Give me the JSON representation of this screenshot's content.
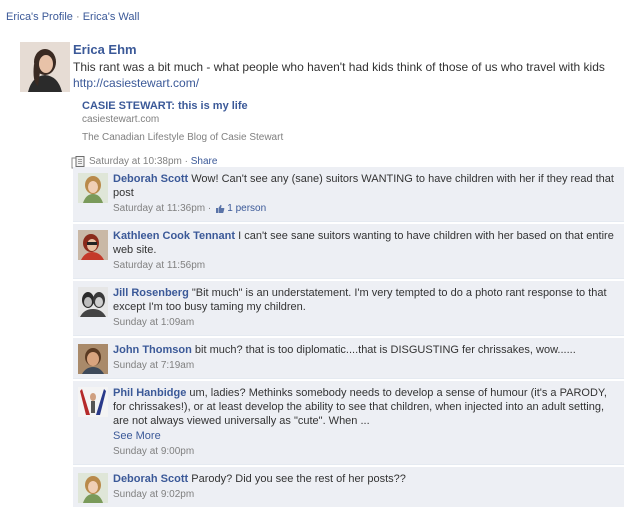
{
  "breadcrumb": {
    "profile": "Erica's Profile",
    "separator": "·",
    "wall": "Erica's Wall"
  },
  "post": {
    "author": "Erica Ehm",
    "text": "This rant was a bit much - what people who haven't had kids think of those of us who travel with kids",
    "link_text": "http://casiestewart.com/",
    "attachment": {
      "title": "CASIE STEWART: this is my life",
      "domain": "casiestewart.com",
      "description": "The Canadian Lifestyle Blog of Casie Stewart"
    },
    "timestamp": "Saturday at 10:38pm",
    "separator": "·",
    "share_label": "Share"
  },
  "comments": [
    {
      "author": "Deborah Scott",
      "text": "Wow! Can't see any (sane) suitors WANTING to have children with her if they read that post",
      "timestamp": "Saturday at 11:36pm",
      "separator": "·",
      "likes": "1 person"
    },
    {
      "author": "Kathleen Cook Tennant",
      "text": "I can't see sane suitors wanting to have children with her based on that entire web site.",
      "timestamp": "Saturday at 11:56pm"
    },
    {
      "author": "Jill Rosenberg",
      "text": "\"Bit much\" is an understatement. I'm very tempted to do a photo rant response to that except I'm too busy taming my children.",
      "timestamp": "Sunday at 1:09am"
    },
    {
      "author": "John Thomson",
      "text": "bit much? that is too diplomatic....that is DISGUSTING fer chrissakes, wow......",
      "timestamp": "Sunday at 7:19am"
    },
    {
      "author": "Phil Hanbidge",
      "text": "um, ladies? Methinks somebody needs to develop a sense of humour (it's a PARODY, for chrissakes!), or at least develop the ability to see that children, when injected into an adult setting, are not always viewed universally as \"cute\". When ...",
      "see_more": "See More",
      "timestamp": "Sunday at 9:00pm"
    },
    {
      "author": "Deborah Scott",
      "text": "Parody? Did you see the rest of her posts??",
      "timestamp": "Sunday at 9:02pm"
    }
  ]
}
